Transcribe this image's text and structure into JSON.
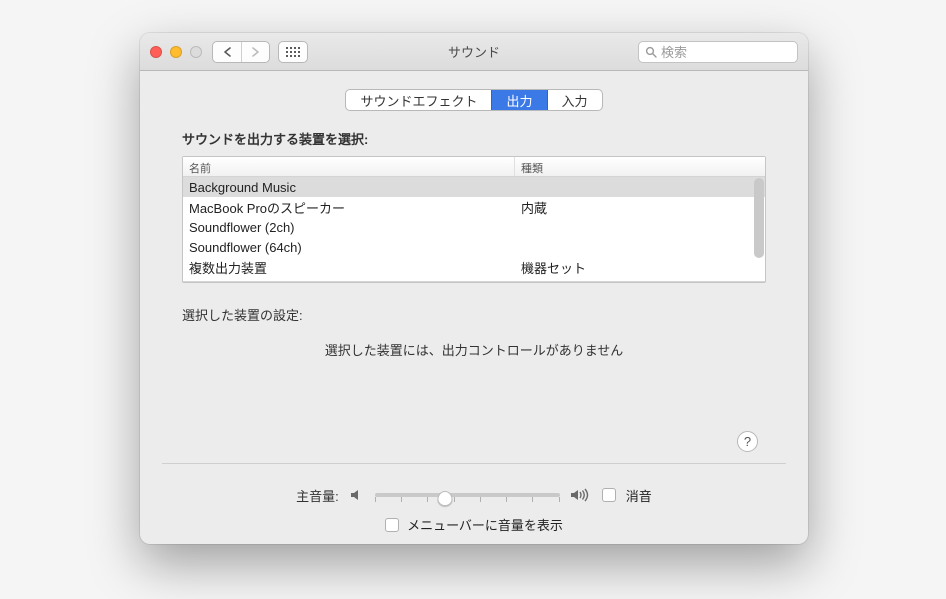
{
  "window": {
    "title": "サウンド",
    "search_placeholder": "検索"
  },
  "tabs": [
    {
      "label": "サウンドエフェクト",
      "active": false
    },
    {
      "label": "出力",
      "active": true
    },
    {
      "label": "入力",
      "active": false
    }
  ],
  "section": {
    "heading": "サウンドを出力する装置を選択:",
    "columns": {
      "name": "名前",
      "type": "種類"
    },
    "devices": [
      {
        "name": "Background Music",
        "type": "",
        "selected": true
      },
      {
        "name": "MacBook Proのスピーカー",
        "type": "内蔵",
        "selected": false
      },
      {
        "name": "Soundflower (2ch)",
        "type": "",
        "selected": false
      },
      {
        "name": "Soundflower (64ch)",
        "type": "",
        "selected": false
      },
      {
        "name": "複数出力装置",
        "type": "機器セット",
        "selected": false
      }
    ],
    "settings_label": "選択した装置の設定:",
    "no_controls_text": "選択した装置には、出力コントロールがありません"
  },
  "footer": {
    "volume_label": "主音量:",
    "mute_label": "消音",
    "show_in_menubar_label": "メニューバーに音量を表示",
    "volume_percent": 40,
    "mute_checked": false,
    "show_in_menubar_checked": false
  },
  "help_glyph": "?"
}
